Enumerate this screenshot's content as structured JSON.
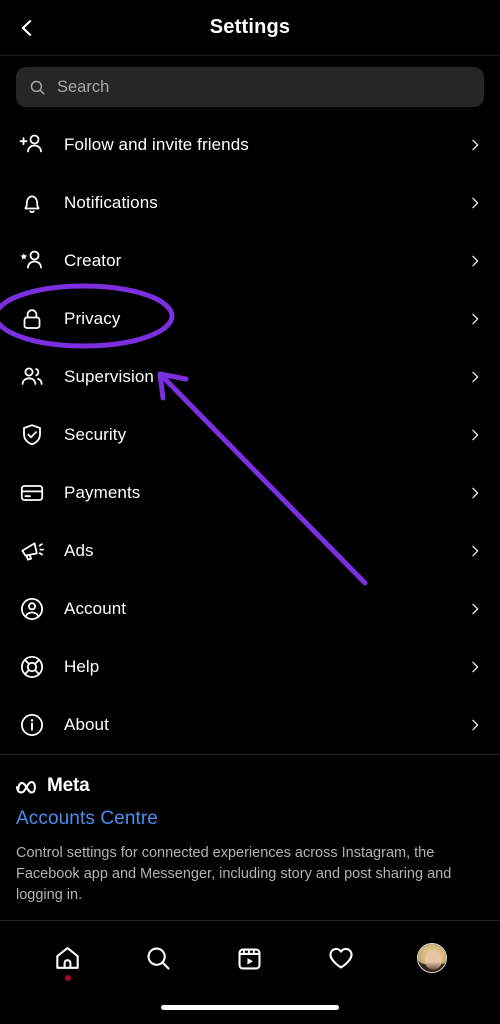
{
  "header": {
    "title": "Settings",
    "back_icon": "chevron-left-icon"
  },
  "search": {
    "placeholder": "Search",
    "icon": "search-icon",
    "value": ""
  },
  "menu": {
    "items": [
      {
        "label": "Follow and invite friends",
        "icon": "person-add-icon"
      },
      {
        "label": "Notifications",
        "icon": "bell-icon"
      },
      {
        "label": "Creator",
        "icon": "person-star-icon"
      },
      {
        "label": "Privacy",
        "icon": "lock-icon"
      },
      {
        "label": "Supervision",
        "icon": "people-icon"
      },
      {
        "label": "Security",
        "icon": "shield-check-icon"
      },
      {
        "label": "Payments",
        "icon": "credit-card-icon"
      },
      {
        "label": "Ads",
        "icon": "megaphone-icon"
      },
      {
        "label": "Account",
        "icon": "person-circle-icon"
      },
      {
        "label": "Help",
        "icon": "lifebuoy-icon"
      },
      {
        "label": "About",
        "icon": "info-circle-icon"
      }
    ],
    "chevron_icon": "chevron-right-icon"
  },
  "meta_section": {
    "brand_icon": "meta-infinity-icon",
    "brand_name": "Meta",
    "link_label": "Accounts Centre",
    "description": "Control settings for connected experiences across Instagram, the Facebook app and Messenger, including story and post sharing and logging in."
  },
  "bottom_nav": {
    "items": [
      {
        "name": "home",
        "icon": "home-icon",
        "badge": true
      },
      {
        "name": "search",
        "icon": "search-icon",
        "badge": false
      },
      {
        "name": "reels",
        "icon": "reels-icon",
        "badge": false
      },
      {
        "name": "activity",
        "icon": "heart-icon",
        "badge": false
      },
      {
        "name": "profile",
        "icon": "avatar-icon",
        "badge": false
      }
    ]
  },
  "annotation": {
    "highlight_target": "Privacy",
    "arrow_target": "Supervision",
    "color": "#7b2fe0",
    "shape": "ellipse-and-arrow"
  },
  "colors": {
    "background": "#000000",
    "search_field": "#262626",
    "link_blue": "#4a8ff0",
    "annotation_purple": "#7b2fe0",
    "badge_red": "#b3002d",
    "muted_text": "#b3b3b3"
  }
}
